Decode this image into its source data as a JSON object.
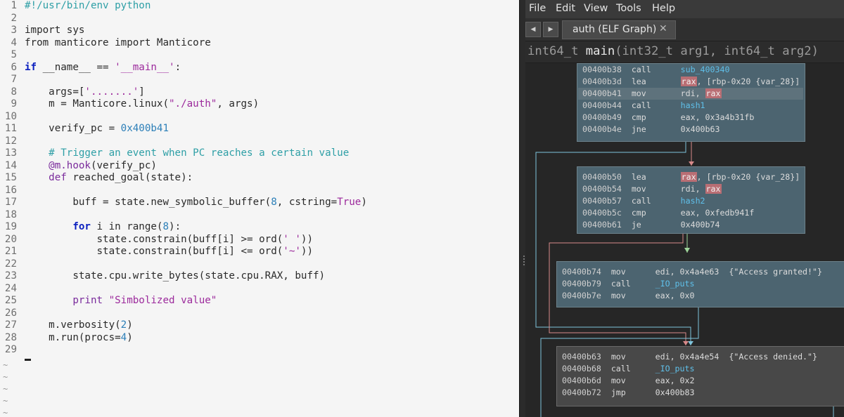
{
  "editor": {
    "line_numbers": [
      "1",
      "2",
      "3",
      "4",
      "5",
      "6",
      "7",
      "8",
      "9",
      "10",
      "11",
      "12",
      "13",
      "14",
      "15",
      "16",
      "17",
      "18",
      "19",
      "20",
      "21",
      "22",
      "23",
      "24",
      "25",
      "26",
      "27",
      "28",
      "29"
    ],
    "tilde": "~",
    "code": {
      "l1": "#!/usr/bin/env python",
      "l3_kw": "import",
      "l3_rest": " sys",
      "l4_kw1": "from",
      "l4_mid": " manticore ",
      "l4_kw2": "import",
      "l4_rest": " Manticore",
      "l6_kw": "if",
      "l6_mid": " __name__ == ",
      "l6_str": "'__main__'",
      "l6_end": ":",
      "l8_a": "    args=[",
      "l8_str": "'.......'",
      "l8_b": "]",
      "l9_a": "    m = Manticore.linux(",
      "l9_str": "\"./auth\"",
      "l9_b": ", args)",
      "l11_a": "    verify_pc = ",
      "l11_num": "0x400b41",
      "l13": "    # Trigger an event when PC reaches a certain value",
      "l14_dec": "    @m.hook",
      "l14_b": "(verify_pc)",
      "l15_kw": "    def",
      "l15_fn": " reached_goal",
      "l15_b": "(state):",
      "l17_a": "        buff = state.new_symbolic_buffer(",
      "l17_num": "8",
      "l17_b": ", cstring=",
      "l17_bl": "True",
      "l17_c": ")",
      "l19_kw": "        for",
      "l19_a": " i ",
      "l19_in": "in",
      "l19_b": " range(",
      "l19_num": "8",
      "l19_c": "):",
      "l20_a": "            state.constrain(buff[i] >= ord(",
      "l20_str": "' '",
      "l20_b": "))",
      "l21_a": "            state.constrain(buff[i] <= ord(",
      "l21_str": "'~'",
      "l21_b": "))",
      "l23": "        state.cpu.write_bytes(state.cpu.RAX, buff)",
      "l25_kw": "        print",
      "l25_str": " \"Simbolized value\"",
      "l27_a": "    m.verbosity(",
      "l27_num": "2",
      "l27_b": ")",
      "l28_a": "    m.run(procs=",
      "l28_num": "4",
      "l28_b": ")"
    }
  },
  "binja": {
    "menu": [
      "File",
      "Edit",
      "View",
      "Tools",
      "Help"
    ],
    "nav_back": "◀",
    "nav_forward": "▶",
    "tab_label": "auth (ELF Graph)",
    "tab_close": "✕",
    "signature": {
      "ret": "int64_t ",
      "name": "main",
      "args": "(int32_t arg1, int64_t arg2)"
    },
    "blocks": [
      {
        "rows": [
          {
            "addr": "00400b38",
            "op": "call",
            "sym": "sub_400340"
          },
          {
            "addr": "00400b3d",
            "op": "lea",
            "reg": "rax",
            "rest": ", [rbp-0x20 {var_28}]"
          },
          {
            "addr": "00400b41",
            "op": "mov",
            "pre": "rdi, ",
            "reg": "rax"
          },
          {
            "addr": "00400b44",
            "op": "call",
            "sym": "hash1"
          },
          {
            "addr": "00400b49",
            "op": "cmp",
            "rest": "eax, 0x3a4b31fb"
          },
          {
            "addr": "00400b4e",
            "op": "jne",
            "rest": "0x400b63"
          }
        ]
      },
      {
        "rows": [
          {
            "addr": "00400b50",
            "op": "lea",
            "reg": "rax",
            "rest": ", [rbp-0x20 {var_28}]"
          },
          {
            "addr": "00400b54",
            "op": "mov",
            "pre": "rdi, ",
            "reg": "rax"
          },
          {
            "addr": "00400b57",
            "op": "call",
            "sym": "hash2"
          },
          {
            "addr": "00400b5c",
            "op": "cmp",
            "rest": "eax, 0xfedb941f"
          },
          {
            "addr": "00400b61",
            "op": "je",
            "rest": "0x400b74"
          }
        ]
      },
      {
        "rows": [
          {
            "addr": "00400b74",
            "op": "mov",
            "rest": "edi, 0x4a4e63  {\"Access granted!\"}"
          },
          {
            "addr": "00400b79",
            "op": "call",
            "sym": "_IO_puts"
          },
          {
            "addr": "00400b7e",
            "op": "mov",
            "rest": "eax, 0x0"
          }
        ]
      },
      {
        "rows": [
          {
            "addr": "00400b63",
            "op": "mov",
            "rest": "edi, 0x4a4e54  {\"Access denied.\"}"
          },
          {
            "addr": "00400b68",
            "op": "call",
            "sym": "_IO_puts"
          },
          {
            "addr": "00400b6d",
            "op": "mov",
            "rest": "eax, 0x2"
          },
          {
            "addr": "00400b72",
            "op": "jmp",
            "rest": "0x400b83"
          }
        ]
      }
    ],
    "colors": {
      "edge_true": "#9ed59a",
      "edge_false": "#d88a8a",
      "edge_uncond": "#7fc4dc",
      "block_bg": "#4c6470",
      "register_hl": "#b96e74"
    }
  }
}
